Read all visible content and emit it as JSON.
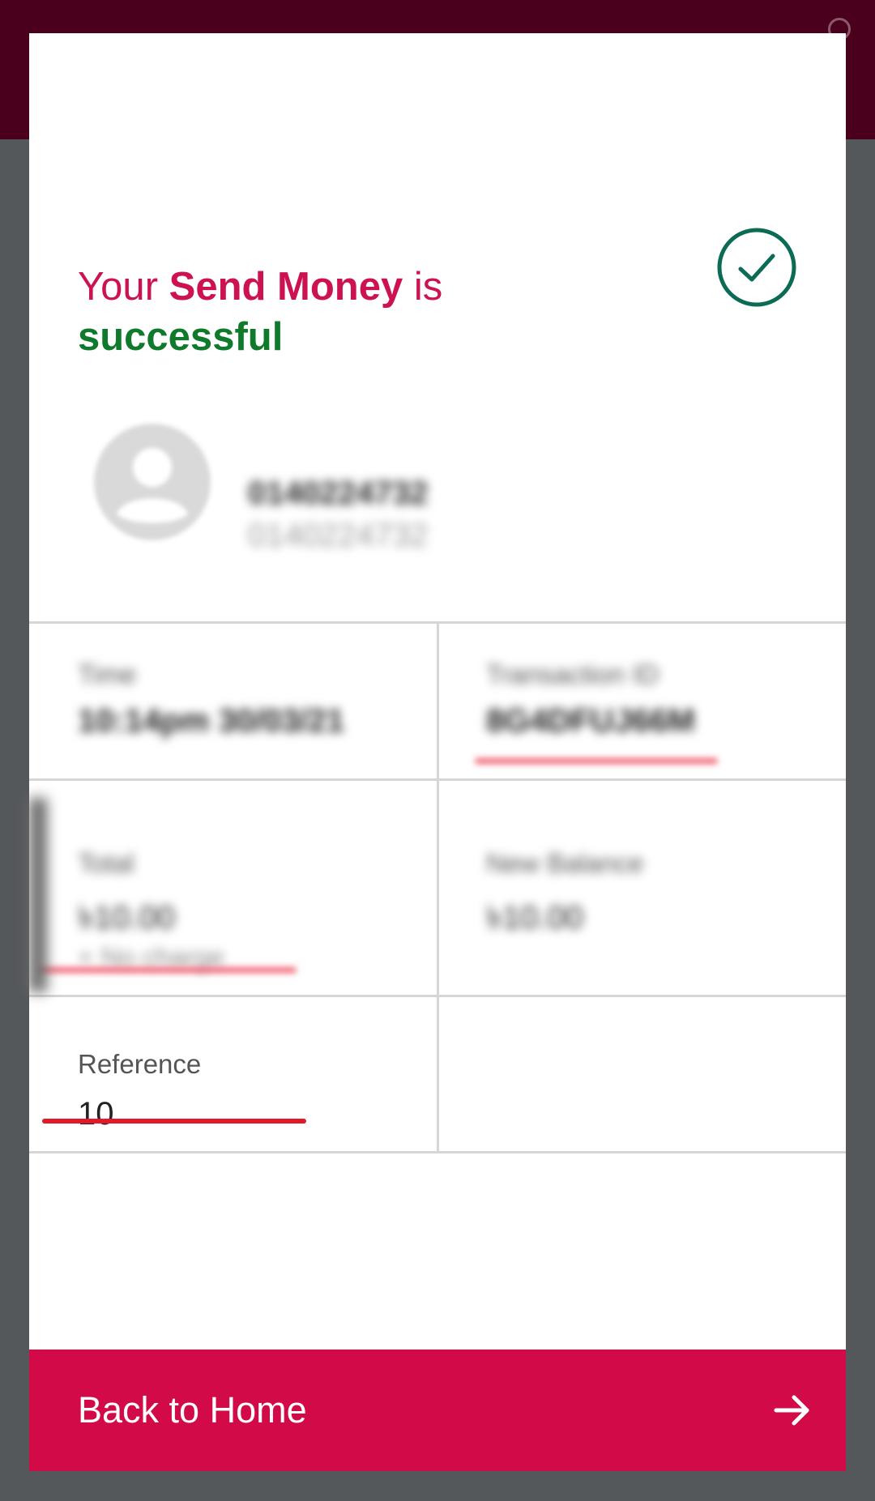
{
  "colors": {
    "brand": "#d20a47",
    "success": "#0f7a2b",
    "top_bar": "#4a001d",
    "backdrop": "#55585b"
  },
  "status": {
    "prefix": "Your",
    "action": "Send Money",
    "suffix": "is",
    "result": "successful",
    "icon": "check-circle-icon"
  },
  "recipient": {
    "name": "0140224732",
    "number": "0140224732",
    "avatar_icon": "person-avatar-icon"
  },
  "details": {
    "time": {
      "label": "Time",
      "value": "10:14pm 30/03/21"
    },
    "transaction_id": {
      "label": "Transaction ID",
      "value": "8G4DFUJ66M"
    },
    "total": {
      "label": "Total",
      "value": "৳10.00",
      "note": "+ No charge"
    },
    "new_balance": {
      "label": "New Balance",
      "value": "৳10.00"
    },
    "reference": {
      "label": "Reference",
      "value": "10"
    }
  },
  "footer": {
    "back_label": "Back to Home",
    "arrow_icon": "arrow-right-icon"
  }
}
